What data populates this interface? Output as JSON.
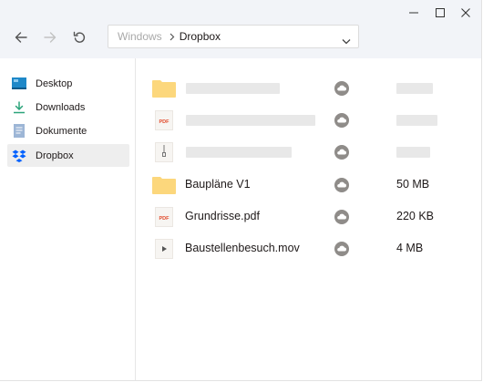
{
  "window": {
    "controls": [
      {
        "name": "minimize-button",
        "icon": "minimize-icon"
      },
      {
        "name": "maximize-button",
        "icon": "maximize-icon"
      },
      {
        "name": "close-button",
        "icon": "close-icon"
      }
    ]
  },
  "toolbar": {
    "back_icon": "arrow-left-icon",
    "forward_icon": "arrow-right-icon",
    "refresh_icon": "refresh-icon"
  },
  "path": {
    "root": "Windows",
    "current": "Dropbox"
  },
  "sidebar": {
    "items": [
      {
        "label": "Desktop",
        "icon": "desktop-icon",
        "selected": false
      },
      {
        "label": "Downloads",
        "icon": "download-icon",
        "selected": false
      },
      {
        "label": "Dokumente",
        "icon": "document-icon",
        "selected": false
      },
      {
        "label": "Dropbox",
        "icon": "dropbox-icon",
        "selected": true
      }
    ]
  },
  "files": {
    "loading_rows": [
      {
        "icon": "folder-icon"
      },
      {
        "icon": "pdf-icon"
      },
      {
        "icon": "zip-icon"
      }
    ],
    "rows": [
      {
        "name": "Baupläne V1",
        "icon": "folder-icon",
        "size": "50 MB",
        "status_icon": "cloud-icon"
      },
      {
        "name": "Grundrisse.pdf",
        "icon": "pdf-icon",
        "size": "220 KB",
        "status_icon": "cloud-icon"
      },
      {
        "name": "Baustellenbesuch.mov",
        "icon": "video-icon",
        "size": "4 MB",
        "status_icon": "cloud-icon"
      }
    ]
  },
  "colors": {
    "titlebar_bg": "#f2f4f8",
    "folder": "#fcd77c",
    "dropbox_blue": "#0061fe",
    "sync_grey": "#8f8c89",
    "placeholder": "#e8e8e8",
    "selected_bg": "#eeeeee"
  }
}
